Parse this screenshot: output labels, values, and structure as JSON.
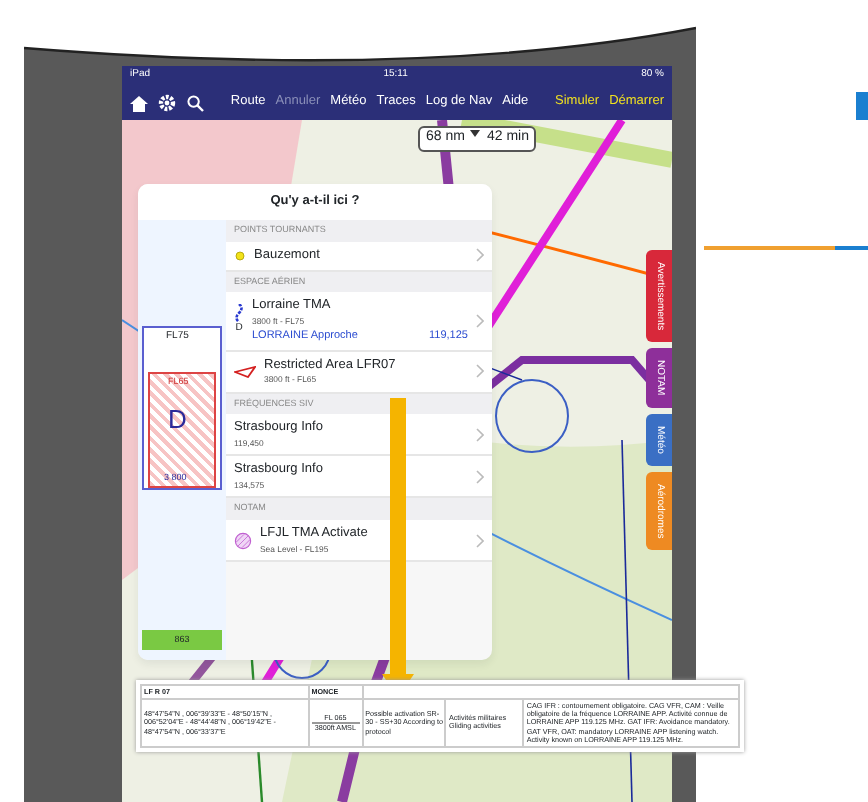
{
  "status_bar": {
    "carrier": "iPad",
    "time": "15:11",
    "battery": "80 %"
  },
  "nav": {
    "items": [
      {
        "label": "Route",
        "disabled": false
      },
      {
        "label": "Annuler",
        "disabled": true
      },
      {
        "label": "Météo",
        "disabled": false
      },
      {
        "label": "Traces",
        "disabled": false
      },
      {
        "label": "Log de Nav",
        "disabled": false
      },
      {
        "label": "Aide",
        "disabled": false
      }
    ],
    "actions": [
      "Simuler",
      "Démarrer"
    ]
  },
  "route_pill": {
    "distance": "68 nm",
    "time": "42 min"
  },
  "popup": {
    "title": "Qu'y a-t-il ici ?",
    "profile": {
      "top": "FL75",
      "inner_top": "FL65",
      "airspace_class": "D",
      "bottom": "3 800",
      "ground": "863"
    },
    "sections": [
      {
        "heading": "POINTS TOURNANTS",
        "items": [
          {
            "kind": "waypoint",
            "title": "Bauzemont"
          }
        ]
      },
      {
        "heading": "ESPACE AÉRIEN",
        "items": [
          {
            "kind": "tma",
            "title": "Lorraine TMA",
            "subtitle": "3800 ft - FL75",
            "link": "LORRAINE Approche",
            "frequency": "119,125",
            "icon_label": "D"
          },
          {
            "kind": "restricted",
            "title": "Restricted Area LFR07",
            "subtitle": "3800 ft - FL65"
          }
        ]
      },
      {
        "heading": "FRÉQUENCES SIV",
        "items": [
          {
            "kind": "frequency",
            "title": "Strasbourg Info",
            "subtitle": "119,450"
          },
          {
            "kind": "frequency",
            "title": "Strasbourg Info",
            "subtitle": "134,575"
          }
        ]
      },
      {
        "heading": "NOTAM",
        "items": [
          {
            "kind": "notam",
            "title": "LFJL TMA Activate",
            "subtitle": "Sea Level - FL195"
          }
        ]
      }
    ]
  },
  "side_tabs": [
    {
      "label": "Avertissements",
      "color": "#d8283a"
    },
    {
      "label": "NOTAM",
      "color": "#8e2f9a"
    },
    {
      "label": "Météo",
      "color": "#3a6fc4"
    },
    {
      "label": "Aérodromes",
      "color": "#ee8a22"
    }
  ],
  "document": {
    "header": [
      "LF R 07",
      "MONCE"
    ],
    "row": [
      "48°47'54\"N , 006°39'33\"E - 48°50'15\"N , 006°52'04\"E - 48°44'48\"N , 006°19'42\"E - 48°47'54\"N , 006°33'37\"E",
      "FL 065",
      "3800ft AMSL",
      "Possible activation SR-30 - SS+30 According to protocol",
      "Activités militaires Gliding activities",
      "CAG IFR : contournement obligatoire. CAG VFR, CAM : Veille obligatoire de la fréquence LORRAINE APP. Activité connue de LORRAINE APP 119.125 MHz. GAT IFR: Avoidance mandatory. GAT VFR, OAT: mandatory LORRAINE APP listening watch. Activity known on LORRAINE APP 119.125 MHz."
    ]
  }
}
